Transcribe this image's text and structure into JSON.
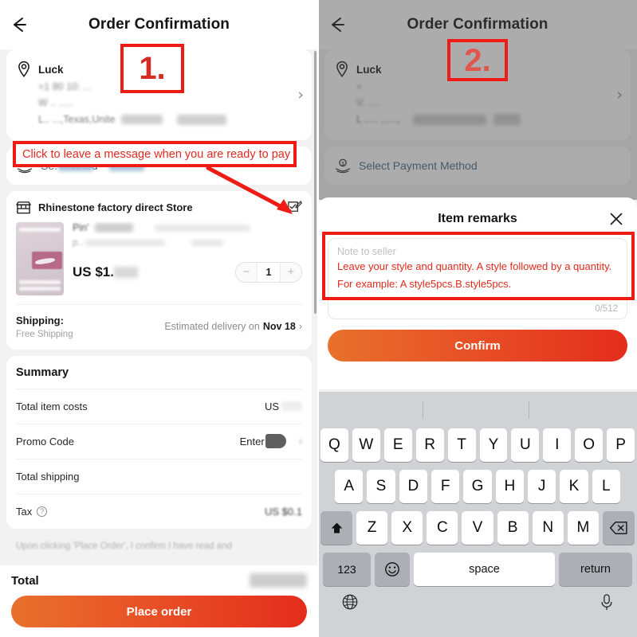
{
  "left": {
    "header": {
      "title": "Order Confirmation",
      "back_icon": "back-arrow-icon"
    },
    "address": {
      "pin_icon": "location-pin-icon",
      "name": "Luck",
      "line_phone": "+1 80 10: ...",
      "line_2": "W .. .....",
      "line_3": "L.. ...,Texas,Unite",
      "chevron": "›"
    },
    "payment": {
      "icon": "payment-hand-icon",
      "label": "Se.        method"
    },
    "store": {
      "icon": "storefront-icon",
      "name": "Rhinestone factory direct Store",
      "edit_icon": "edit-note-icon",
      "product": {
        "title": "Pin'",
        "sku": "p..   ",
        "price": "US $1.",
        "qty": "1",
        "minus": "−",
        "plus": "+"
      },
      "shipping": {
        "label": "Shipping:",
        "sub": "Free Shipping",
        "estimate_prefix": "Estimated delivery on",
        "estimate_date": "Nov 18",
        "chevron": "›"
      }
    },
    "summary": {
      "title": "Summary",
      "rows": [
        {
          "key": "Total item costs",
          "value": "US"
        },
        {
          "key": "Promo Code",
          "value": "Enter"
        },
        {
          "key": "Total shipping",
          "value": ""
        },
        {
          "key": "Tax",
          "value": "US $0.1"
        }
      ],
      "tax_help_icon": "question-mark-icon"
    },
    "disclaimer": "Upon clicking 'Place Order', I confirm I have read and",
    "footer": {
      "total_label": "Total",
      "cta_label": "Place order"
    }
  },
  "right": {
    "header": {
      "title": "Order Confirmation",
      "back_icon": "back-arrow-icon"
    },
    "address": {
      "pin_icon": "location-pin-icon",
      "name": "Luck",
      "line_phone": "+",
      "line_2": "V. .....",
      "line_3": "L .....  ,.....,",
      "chevron": "›"
    },
    "payment": {
      "icon": "payment-hand-icon",
      "label": "Select Payment Method"
    },
    "sheet": {
      "title": "Item remarks",
      "close_icon": "close-x-icon",
      "note_placeholder": "Note to seller",
      "hint_line1": "Leave your style and quantity. A style followed by a quantity.",
      "hint_line2": "For example: A style5pcs.B.style5pcs.",
      "counter": "0/512",
      "confirm_label": "Confirm"
    },
    "keyboard": {
      "row1": [
        "Q",
        "W",
        "E",
        "R",
        "T",
        "Y",
        "U",
        "I",
        "O",
        "P"
      ],
      "row2": [
        "A",
        "S",
        "D",
        "F",
        "G",
        "H",
        "J",
        "K",
        "L"
      ],
      "row3": [
        "Z",
        "X",
        "C",
        "V",
        "B",
        "N",
        "M"
      ],
      "shift_icon": "shift-arrow-icon",
      "backspace_icon": "backspace-icon",
      "numbers_label": "123",
      "emoji_icon": "smiley-face-icon",
      "space_label": "space",
      "return_label": "return",
      "globe_icon": "globe-icon",
      "mic_icon": "microphone-icon"
    }
  },
  "annotations": {
    "step1": "1.",
    "step2": "2.",
    "callout": "Click to leave a message when you are ready to pay"
  },
  "colors": {
    "accent_orange": "#e8712c",
    "accent_red": "#e42d1c",
    "annotation_red": "#ef1c15",
    "link_blue": "#4a6b84",
    "keyboard_bg": "#d1d2d6"
  }
}
